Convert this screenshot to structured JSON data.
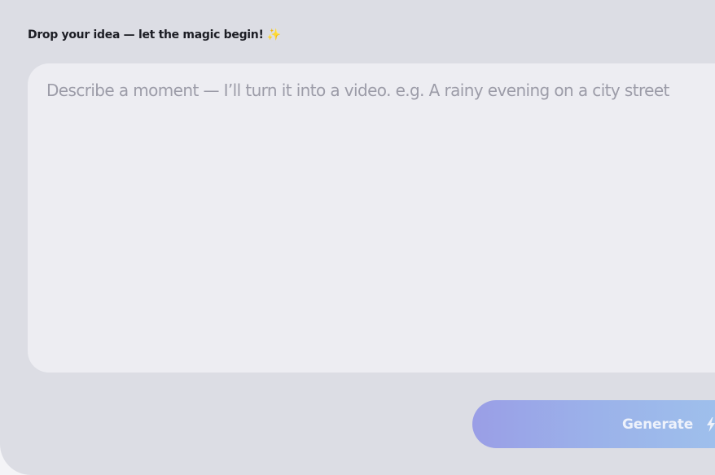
{
  "form": {
    "label": "Drop your idea — let the magic begin!",
    "label_icon": "sparkle-icon",
    "prompt": {
      "value": "",
      "placeholder": "Describe a moment — I’ll turn it into a video. e.g. A rainy evening on a city street"
    },
    "generate_button": {
      "label": "Generate",
      "icon": "lightning-bolt-icon"
    }
  },
  "colors": {
    "panel_background": "#dcdde4",
    "input_background": "#ededf2",
    "label_text": "#1c1d24",
    "placeholder_text": "#9c9ca8",
    "button_gradient_start": "#9a9ee6",
    "button_gradient_end": "#9fc3ec",
    "button_text": "#eef2fb",
    "sparkle": "#f3d27a"
  }
}
